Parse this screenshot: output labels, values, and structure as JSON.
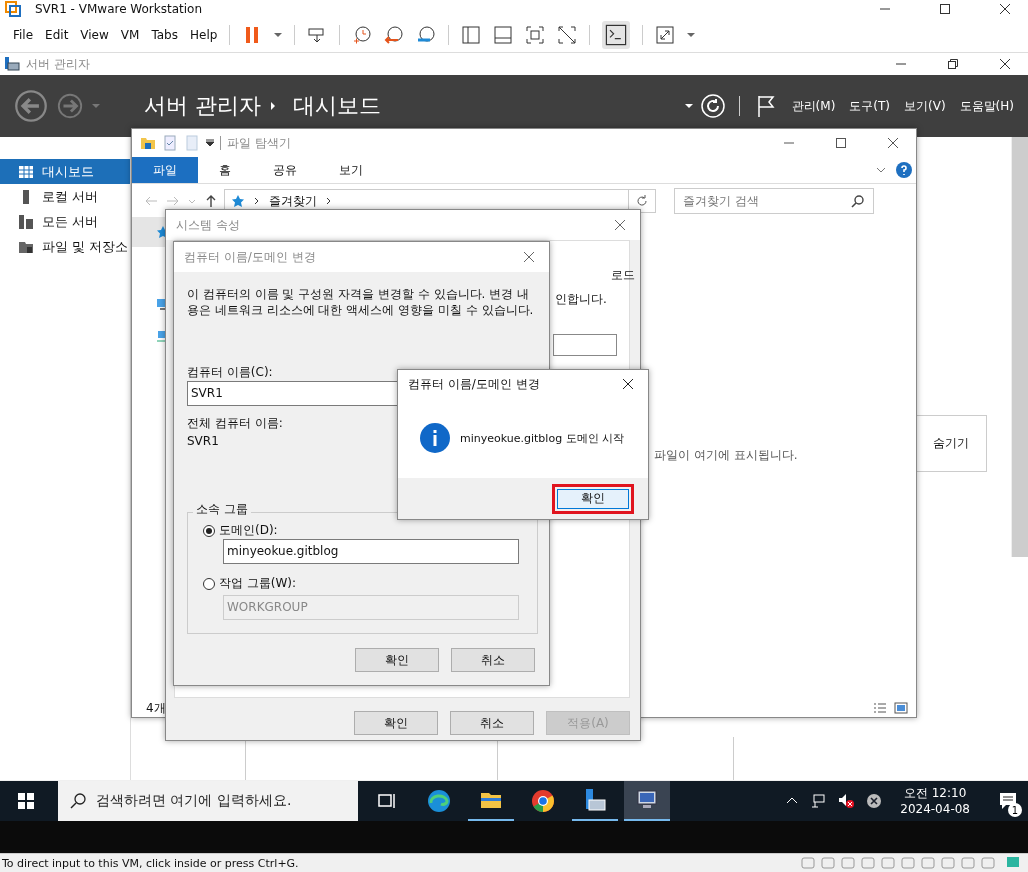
{
  "window": {
    "title": "SVR1 - VMware Workstation"
  },
  "menu": [
    "File",
    "Edit",
    "View",
    "VM",
    "Tabs",
    "Help"
  ],
  "server_manager": {
    "title": "서버 관리자",
    "breadcrumb": [
      "서버 관리자",
      "대시보드"
    ],
    "menu": [
      "관리(M)",
      "도구(T)",
      "보기(V)",
      "도움말(H)"
    ],
    "sidebar": [
      {
        "label": "대시보드",
        "selected": true,
        "kind": "dashboard"
      },
      {
        "label": "로컬 서버",
        "selected": false,
        "kind": "local"
      },
      {
        "label": "모든 서버",
        "selected": false,
        "kind": "all"
      },
      {
        "label": "파일 및 저장소",
        "selected": false,
        "kind": "files"
      }
    ],
    "hide_button": "숨기기"
  },
  "explorer": {
    "title": "파일 탐색기",
    "tabs": [
      {
        "label": "파일",
        "selected": true
      },
      {
        "label": "홈",
        "selected": false
      },
      {
        "label": "공유",
        "selected": false
      },
      {
        "label": "보기",
        "selected": false
      }
    ],
    "address": "즐겨찾기",
    "search": {
      "placeholder": "즐겨찾기 검색"
    },
    "empty_text": "파일이 여기에 표시됩니다.",
    "status": "4개"
  },
  "system_properties": {
    "title": "시스템 속성",
    "tab_text": "로드",
    "info_text": "인합니다.",
    "buttons": [
      {
        "label": "확인",
        "disabled": false
      },
      {
        "label": "취소",
        "disabled": false
      },
      {
        "label": "적용(A)",
        "disabled": true
      }
    ]
  },
  "name_dialog": {
    "title": "컴퓨터 이름/도메인 변경",
    "description": "이 컴퓨터의 이름 및 구성원 자격을 변경할 수 있습니다. 변경 내용은 네트워크 리소스에 대한 액세스에 영향을 미칠 수 있습니다.",
    "computer_name_label": "컴퓨터 이름(C):",
    "computer_name": "SVR1",
    "full_name_label": "전체 컴퓨터 이름:",
    "full_name": "SVR1",
    "group_title": "소속 그룹",
    "options": [
      {
        "label": "도메인(D):",
        "selected": true,
        "value": "minyeokue.gitblog",
        "disabled": false
      },
      {
        "label": "작업 그룹(W):",
        "selected": false,
        "value": "WORKGROUP",
        "disabled": true
      }
    ],
    "buttons": [
      "확인",
      "취소"
    ]
  },
  "message_box": {
    "title": "컴퓨터 이름/도메인 변경",
    "message": "minyeokue.gitblog 도메인 시작",
    "button": "확인",
    "highlighted": true
  },
  "taskbar": {
    "search": {
      "placeholder": "검색하려면 여기에 입력하세요."
    },
    "apps": [
      {
        "kind": "taskview",
        "running": false,
        "selected": false
      },
      {
        "kind": "edge",
        "running": false,
        "selected": false
      },
      {
        "kind": "folder",
        "running": true,
        "selected": false
      },
      {
        "kind": "chrome",
        "running": false,
        "selected": false
      },
      {
        "kind": "server",
        "running": true,
        "selected": false
      },
      {
        "kind": "computer",
        "running": true,
        "selected": true
      }
    ],
    "time": "오전 12:10",
    "date": "2024-04-08",
    "notifications": "1"
  },
  "status_bar": "To direct input to this VM, click inside or press Ctrl+G."
}
